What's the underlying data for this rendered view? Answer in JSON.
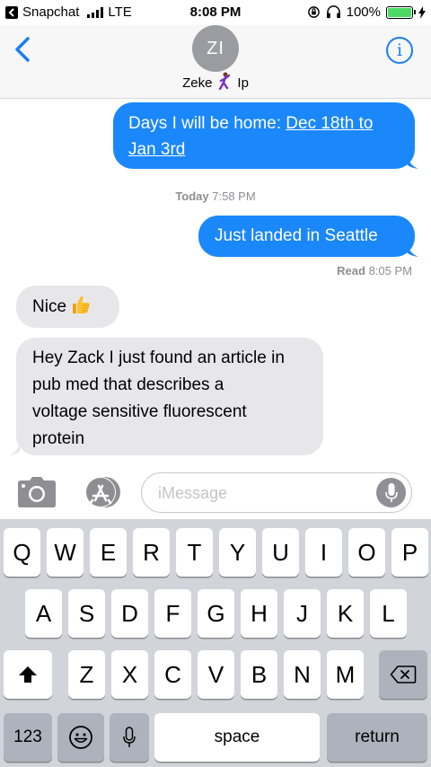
{
  "status_bar": {
    "back_app": "Snapchat",
    "carrier": "LTE",
    "time": "8:08 PM",
    "battery": "100%",
    "battery_level": 1.0
  },
  "header": {
    "back_icon": "chevron-left-icon",
    "avatar_initials": "ZI",
    "contact_first": "Zeke",
    "contact_last": "Ip",
    "info_icon": "info-icon"
  },
  "messages": [
    {
      "direction": "outgoing",
      "text_prefix": "Days I will be home: ",
      "text_link": "Dec 18th to",
      "text_link2": "Jan 3rd"
    },
    {
      "timestamp_day": "Today",
      "timestamp_time": "7:58 PM"
    },
    {
      "direction": "outgoing",
      "text": "Just landed in Seattle"
    },
    {
      "receipt_label": "Read",
      "receipt_time": "8:05 PM"
    },
    {
      "direction": "incoming",
      "text": "Nice"
    },
    {
      "direction": "incoming",
      "lines": [
        "Hey Zack I just found an article in",
        "pub med that describes a",
        "voltage sensitive fluorescent",
        "protein"
      ]
    }
  ],
  "input": {
    "placeholder": "iMessage"
  },
  "keyboard": {
    "row1": [
      "Q",
      "W",
      "E",
      "R",
      "T",
      "Y",
      "U",
      "I",
      "O",
      "P"
    ],
    "row2": [
      "A",
      "S",
      "D",
      "F",
      "G",
      "H",
      "J",
      "K",
      "L"
    ],
    "row3": [
      "Z",
      "X",
      "C",
      "V",
      "B",
      "N",
      "M"
    ],
    "numbers_label": "123",
    "space_label": "space",
    "return_label": "return"
  },
  "colors": {
    "outgoing_bubble": "#1a87fb",
    "incoming_bubble": "#e7e7ea",
    "accent": "#1a7ef2",
    "battery": "#4cd964"
  }
}
